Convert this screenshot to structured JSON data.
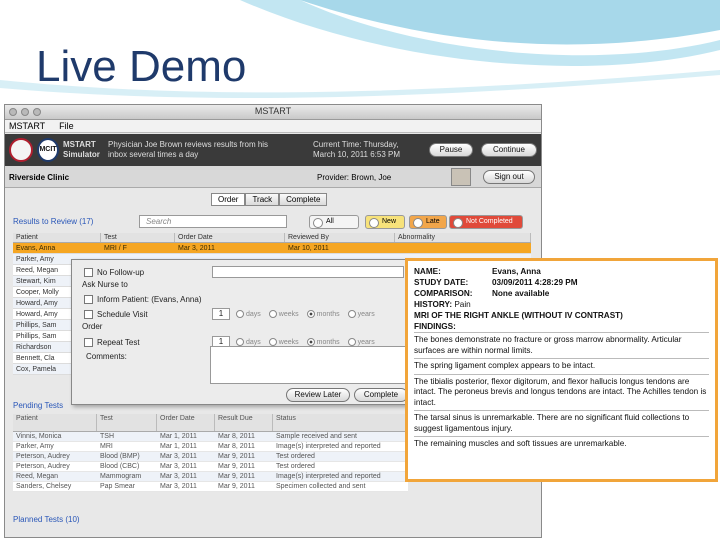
{
  "slide": {
    "title": "Live Demo"
  },
  "window": {
    "title": "MSTART",
    "menus": [
      "MSTART",
      "File"
    ]
  },
  "app_header": {
    "app_name_line1": "MSTART",
    "app_name_line2": "Simulator",
    "scenario_line1": "Physician Joe Brown reviews results from his",
    "scenario_line2": "inbox several times a day",
    "time_line1": "Current Time: Thursday,",
    "time_line2": "March 10, 2011  6:53 PM",
    "pause_label": "Pause",
    "continue_label": "Continue"
  },
  "clinic_bar": {
    "clinic": "Riverside Clinic",
    "provider": "Provider: Brown, Joe",
    "signout_label": "Sign out"
  },
  "tabs": [
    "Order",
    "Track",
    "Complete"
  ],
  "results": {
    "label": "Results to Review (17)",
    "search_placeholder": "Search",
    "filters": [
      "All",
      "New",
      "Late",
      "Not Completed"
    ],
    "columns": [
      "Patient",
      "Test",
      "Order Date",
      "Reviewed By",
      "Abnormality"
    ],
    "rows": [
      [
        "Evans, Anna",
        "MRI / F",
        "Mar 3, 2011",
        "Mar 10, 2011",
        ""
      ],
      [
        "Parker, Amy",
        "",
        "",
        "",
        ""
      ],
      [
        "Reed, Megan",
        "",
        "",
        "",
        ""
      ],
      [
        "Stewart, Kim",
        "",
        "",
        "",
        ""
      ],
      [
        "Cooper, Molly",
        "",
        "",
        "",
        ""
      ],
      [
        "Howard, Amy",
        "",
        "",
        "",
        ""
      ],
      [
        "Howard, Amy",
        "",
        "",
        "",
        ""
      ],
      [
        "Phillips, Sam",
        "",
        "",
        "",
        ""
      ],
      [
        "Phillips, Sam",
        "",
        "",
        "",
        ""
      ],
      [
        "Richardson",
        "",
        "",
        "",
        ""
      ],
      [
        "Bennett, Cla",
        "",
        "",
        "",
        ""
      ],
      [
        "Cox, Pamela",
        "",
        "",
        "",
        ""
      ]
    ]
  },
  "order_popup": {
    "no_followup": "No Follow-up",
    "ask_nurse": "Ask Nurse to",
    "inform_patient": "Inform Patient: (Evans, Anna)",
    "schedule_visit": "Schedule Visit",
    "order_label": "Order",
    "repeat_test": "Repeat Test",
    "comments_label": "Comments:",
    "visit_qty": "1",
    "repeat_qty": "1",
    "units": [
      "days",
      "weeks",
      "months",
      "years"
    ],
    "review_later_label": "Review Later",
    "complete_label": "Complete"
  },
  "pending": {
    "label": "Pending Tests",
    "columns": [
      "Patient",
      "Test",
      "Order Date",
      "Result Due",
      "Status"
    ],
    "rows": [
      [
        "Vinnis, Monica",
        "TSH",
        "Mar 1, 2011",
        "Mar 8, 2011",
        "Sample received and sent"
      ],
      [
        "Parker, Amy",
        "MRI",
        "Mar 1, 2011",
        "Mar 8, 2011",
        "Image(s) interpreted and reported"
      ],
      [
        "Peterson, Audrey",
        "Blood (BMP)",
        "Mar 3, 2011",
        "Mar 9, 2011",
        "Test ordered"
      ],
      [
        "Peterson, Audrey",
        "Blood (CBC)",
        "Mar 3, 2011",
        "Mar 9, 2011",
        "Test ordered"
      ],
      [
        "Reed, Megan",
        "Mammogram",
        "Mar 3, 2011",
        "Mar 9, 2011",
        "Image(s) interpreted and reported"
      ],
      [
        "Sanders, Chelsey",
        "Pap Smear",
        "Mar 3, 2011",
        "Mar 9, 2011",
        "Specimen collected and sent"
      ]
    ],
    "planned_label": "Planned Tests (10)"
  },
  "report": {
    "name_label": "NAME:",
    "name_value": "Evans, Anna",
    "study_label": "STUDY DATE:",
    "study_value": "03/09/2011  4:28:29 PM",
    "comparison_label": "COMPARISON:",
    "comparison_value": "None available",
    "history_label": "HISTORY:",
    "history_value": "Pain",
    "exam": "MRI OF THE RIGHT ANKLE (WITHOUT IV CONTRAST)",
    "findings_label": "FINDINGS:",
    "findings": [
      "The bones demonstrate no fracture or gross marrow abnormality. Articular surfaces are within normal limits.",
      "The spring ligament complex appears to be intact.",
      "The tibialis posterior, flexor digitorum, and flexor hallucis longus tendons are intact. The peroneus brevis and longus tendons are intact. The Achilles tendon is intact.",
      "The tarsal sinus is unremarkable. There are no significant fluid collections to suggest ligamentous injury.",
      "The remaining muscles and soft tissues are unremarkable."
    ]
  },
  "colors": {
    "title_blue": "#1f3a6b",
    "selected_row": "#f5a623",
    "report_border": "#f1a53a",
    "filter_new": "#f7e27a",
    "filter_late": "#f2a64a",
    "filter_not_completed": "#e04a3a"
  }
}
